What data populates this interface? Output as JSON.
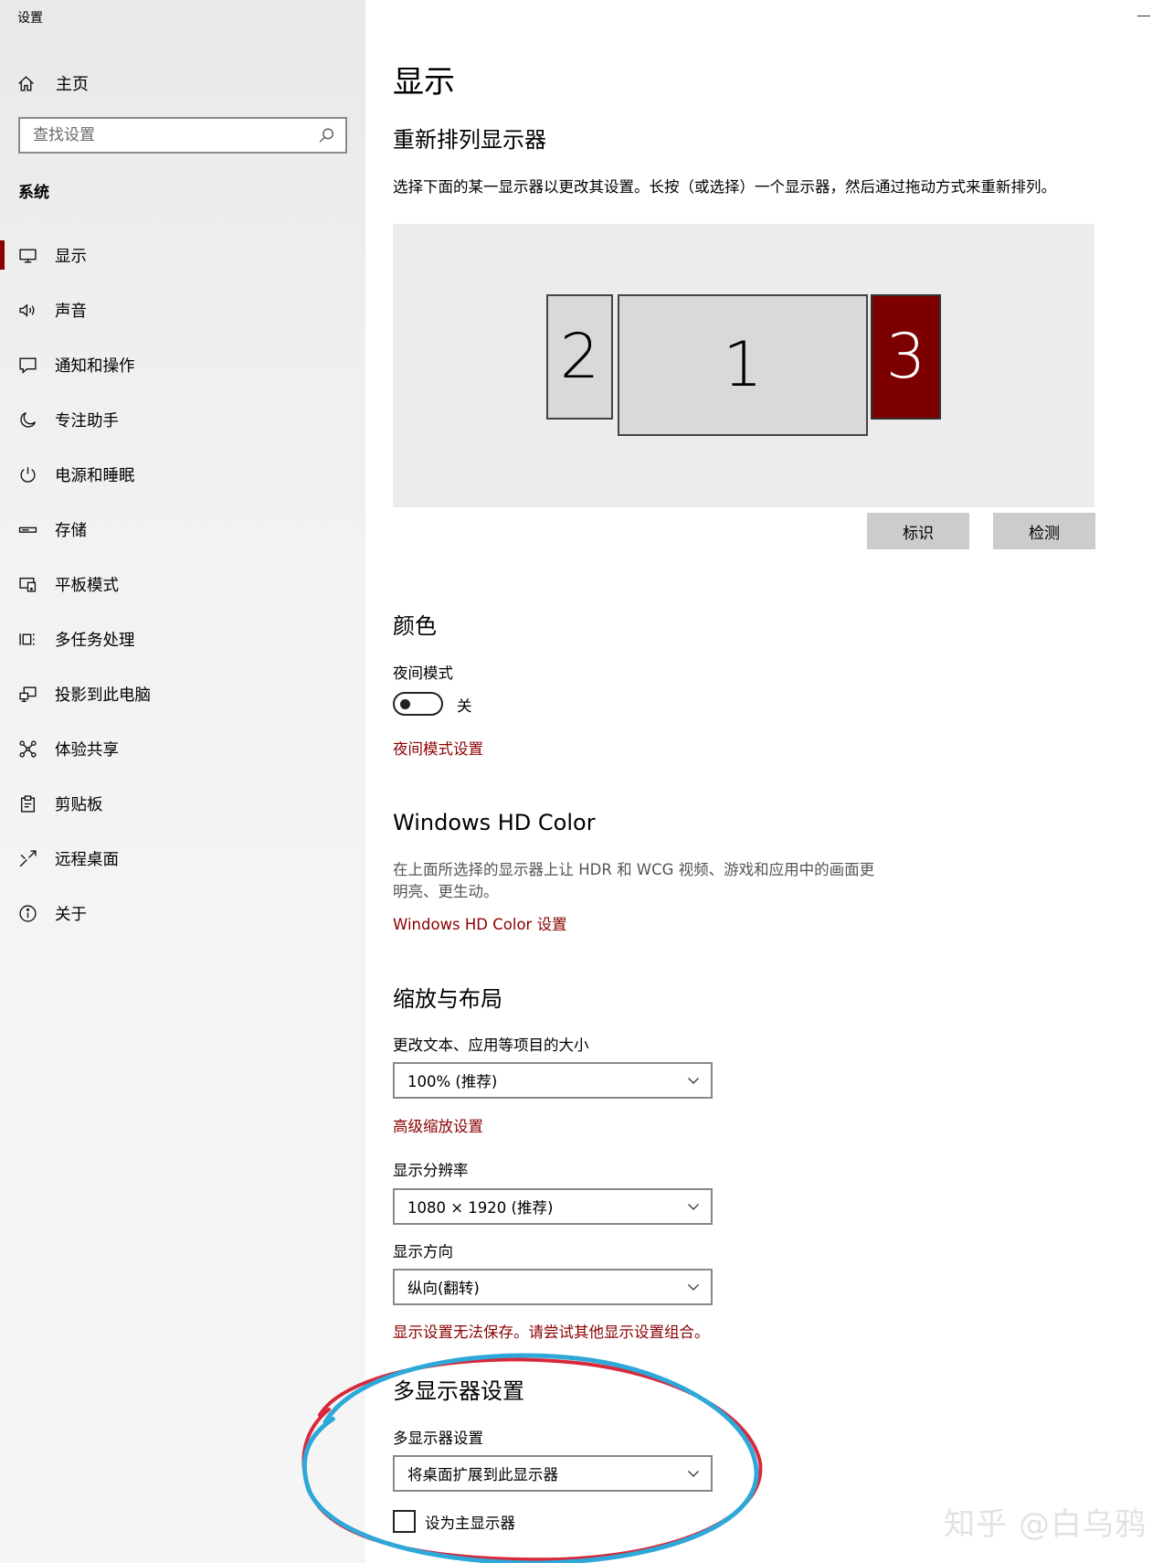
{
  "window": {
    "title": "设置"
  },
  "sidebar": {
    "home_label": "主页",
    "search_placeholder": "查找设置",
    "section_label": "系统",
    "items": [
      {
        "label": "显示",
        "icon": "monitor-icon",
        "active": true
      },
      {
        "label": "声音",
        "icon": "speaker-icon"
      },
      {
        "label": "通知和操作",
        "icon": "notification-icon"
      },
      {
        "label": "专注助手",
        "icon": "moon-icon"
      },
      {
        "label": "电源和睡眠",
        "icon": "power-icon"
      },
      {
        "label": "存储",
        "icon": "storage-icon"
      },
      {
        "label": "平板模式",
        "icon": "tablet-icon"
      },
      {
        "label": "多任务处理",
        "icon": "multitask-icon"
      },
      {
        "label": "投影到此电脑",
        "icon": "project-icon"
      },
      {
        "label": "体验共享",
        "icon": "share-icon"
      },
      {
        "label": "剪贴板",
        "icon": "clipboard-icon"
      },
      {
        "label": "远程桌面",
        "icon": "remote-icon"
      },
      {
        "label": "关于",
        "icon": "info-icon"
      }
    ]
  },
  "main": {
    "title": "显示",
    "arrange": {
      "heading": "重新排列显示器",
      "description": "选择下面的某一显示器以更改其设置。长按（或选择）一个显示器，然后通过拖动方式来重新排列。",
      "monitors": [
        {
          "number": "2",
          "selected": false
        },
        {
          "number": "1",
          "selected": false
        },
        {
          "number": "3",
          "selected": true
        }
      ],
      "identify_button": "标识",
      "detect_button": "检测"
    },
    "color": {
      "heading": "颜色",
      "night_mode_label": "夜间模式",
      "night_mode_state": "关",
      "night_mode_settings_link": "夜间模式设置"
    },
    "hd_color": {
      "heading": "Windows HD Color",
      "description_line1": "在上面所选择的显示器上让 HDR 和 WCG 视频、游戏和应用中的画面更",
      "description_line2": "明亮、更生动。",
      "settings_link": "Windows HD Color 设置"
    },
    "scale_layout": {
      "heading": "缩放与布局",
      "text_size_label": "更改文本、应用等项目的大小",
      "text_size_value": "100% (推荐)",
      "advanced_scaling_link": "高级缩放设置",
      "resolution_label": "显示分辨率",
      "resolution_value": "1080 × 1920 (推荐)",
      "orientation_label": "显示方向",
      "orientation_value": "纵向(翻转)",
      "error_message": "显示设置无法保存。请尝试其他显示设置组合。"
    },
    "multi_display": {
      "heading": "多显示器设置",
      "label": "多显示器设置",
      "value": "将桌面扩展到此显示器",
      "primary_checkbox_label": "设为主显示器",
      "primary_checked": false
    }
  },
  "watermark": "知乎 @白乌鸦",
  "colors": {
    "accent": "#8b0000",
    "selected_monitor": "#7c0000",
    "annotation_blue": "#2ea8d8",
    "annotation_red": "#d8283a"
  }
}
